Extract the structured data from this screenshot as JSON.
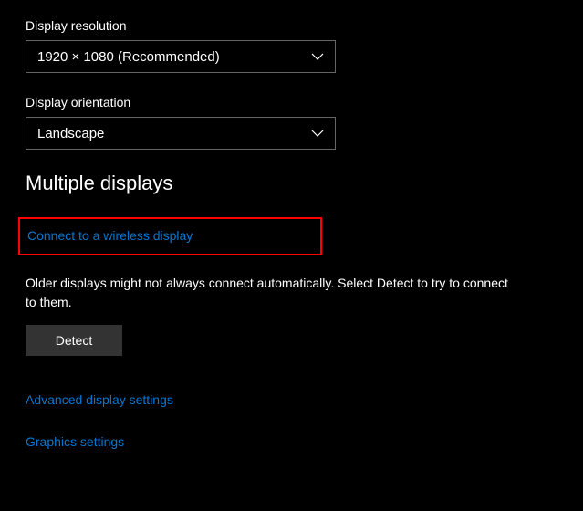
{
  "display": {
    "resolution_label": "Display resolution",
    "resolution_value": "1920 × 1080 (Recommended)",
    "orientation_label": "Display orientation",
    "orientation_value": "Landscape"
  },
  "multiple_displays": {
    "heading": "Multiple displays",
    "connect_link": "Connect to a wireless display",
    "info_text": "Older displays might not always connect automatically. Select Detect to try to connect to them.",
    "detect_button": "Detect"
  },
  "links": {
    "advanced": "Advanced display settings",
    "graphics": "Graphics settings"
  }
}
